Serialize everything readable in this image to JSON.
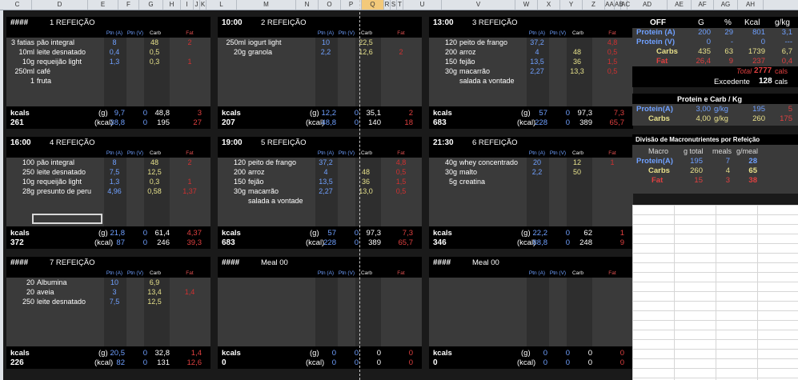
{
  "columns": [
    "C",
    "D",
    "E",
    "F",
    "G",
    "H",
    "I",
    "J",
    "K",
    "L",
    "M",
    "N",
    "O",
    "P",
    "Q",
    "R",
    "S",
    "T",
    "U",
    "V",
    "W",
    "X",
    "Y",
    "Z",
    "AA",
    "AB",
    "AC",
    "AD",
    "AE",
    "AF",
    "AG",
    "AH"
  ],
  "selected_column": "Q",
  "sub_headers": {
    "ptn_a": "Ptn (A)",
    "ptn_v": "Ptn (V)",
    "carb": "Carb",
    "fat": "Fat"
  },
  "labels": {
    "kcals": "kcals",
    "g": "(g)",
    "kcal": "(kcal)"
  },
  "meals": [
    {
      "time": "####",
      "title": "1 REFEIÇÃO",
      "items": [
        {
          "qty": "3 fatias",
          "food": "pão integral",
          "pa": "8",
          "carb": "48",
          "fat": "2"
        },
        {
          "qty": "10ml",
          "food": "leite desnatado",
          "pa": "0,4",
          "carb": "0,5",
          "fat": ""
        },
        {
          "qty": "10g",
          "food": "requeijão light",
          "pa": "1,3",
          "carb": "0,3",
          "fat": "1"
        },
        {
          "qty": "250ml",
          "food": "café",
          "pa": "",
          "carb": "",
          "fat": ""
        },
        {
          "qty": "1",
          "food": "fruta",
          "pa": "",
          "carb": "",
          "fat": ""
        }
      ],
      "kcals": "261",
      "g": {
        "pa": "9,7",
        "pv": "0",
        "carb": "48,8",
        "fat": "3"
      },
      "kcal": {
        "pa": "38,8",
        "pv": "0",
        "carb": "195",
        "fat": "27"
      }
    },
    {
      "time": "10:00",
      "title": "2 REFEIÇÃO",
      "items": [
        {
          "qty": "250ml",
          "food": "iogurt light",
          "pa": "10",
          "carb": "22,5",
          "fat": ""
        },
        {
          "qty": "20g",
          "food": "granola",
          "pa": "2,2",
          "carb": "12,6",
          "fat": "2"
        }
      ],
      "kcals": "207",
      "g": {
        "pa": "12,2",
        "pv": "0",
        "carb": "35,1",
        "fat": "2"
      },
      "kcal": {
        "pa": "48,8",
        "pv": "0",
        "carb": "140",
        "fat": "18"
      }
    },
    {
      "time": "13:00",
      "title": "3 REFEIÇÃO",
      "items": [
        {
          "qty": "120",
          "food": "peito de frango",
          "pa": "37,2",
          "carb": "",
          "fat": "4,8"
        },
        {
          "qty": "200",
          "food": "arroz",
          "pa": "4",
          "carb": "48",
          "fat": "0,5"
        },
        {
          "qty": "150",
          "food": "fejão",
          "pa": "13,5",
          "carb": "36",
          "fat": "1,5"
        },
        {
          "qty": "30g",
          "food": "macarrão",
          "pa": "2,27",
          "carb": "13,3",
          "fat": "0,5"
        },
        {
          "qty": "",
          "food": "salada a vontade",
          "pa": "",
          "carb": "",
          "fat": ""
        }
      ],
      "kcals": "683",
      "g": {
        "pa": "57",
        "pv": "0",
        "carb": "97,3",
        "fat": "7,3"
      },
      "kcal": {
        "pa": "228",
        "pv": "0",
        "carb": "389",
        "fat": "65,7"
      }
    },
    {
      "time": "16:00",
      "title": "4 REFEIÇÃO",
      "items": [
        {
          "qty": "100",
          "food": "pão integral",
          "pa": "8",
          "carb": "48",
          "fat": "2"
        },
        {
          "qty": "250",
          "food": "leite desnatado",
          "pa": "7,5",
          "carb": "12,5",
          "fat": ""
        },
        {
          "qty": "10g",
          "food": "requeijão light",
          "pa": "1,3",
          "carb": "0,3",
          "fat": "1"
        },
        {
          "qty": "28g",
          "food": "presunto de peru",
          "pa": "4,96",
          "carb": "0,58",
          "fat": "1,37"
        }
      ],
      "kcals": "372",
      "g": {
        "pa": "21,8",
        "pv": "0",
        "carb": "61,4",
        "fat": "4,37"
      },
      "kcal": {
        "pa": "87",
        "pv": "0",
        "carb": "246",
        "fat": "39,3"
      }
    },
    {
      "time": "19:00",
      "title": "5 REFEIÇÃO",
      "items": [
        {
          "qty": "120",
          "food": "peito de frango",
          "pa": "37,2",
          "carb": "",
          "fat": "4,8"
        },
        {
          "qty": "200",
          "food": "arroz",
          "pa": "4",
          "carb": "48",
          "fat": "0,5"
        },
        {
          "qty": "150",
          "food": "fejão",
          "pa": "13,5",
          "carb": "36",
          "fat": "1,5"
        },
        {
          "qty": "30g",
          "food": "macarrão",
          "pa": "2,27",
          "carb": "13,0",
          "fat": "0,5"
        },
        {
          "qty": "",
          "food": "salada a vontade",
          "pa": "",
          "carb": "",
          "fat": ""
        }
      ],
      "kcals": "683",
      "g": {
        "pa": "57",
        "pv": "0",
        "carb": "97,3",
        "fat": "7,3"
      },
      "kcal": {
        "pa": "228",
        "pv": "0",
        "carb": "389",
        "fat": "65,7"
      }
    },
    {
      "time": "21:30",
      "title": "6 REFEIÇÃO",
      "items": [
        {
          "qty": "40g",
          "food": "whey concentrado",
          "pa": "20",
          "carb": "12",
          "fat": "1"
        },
        {
          "qty": "30g",
          "food": "malto",
          "pa": "2,2",
          "carb": "50",
          "fat": ""
        },
        {
          "qty": "5g",
          "food": "creatina",
          "pa": "",
          "carb": "",
          "fat": ""
        }
      ],
      "kcals": "346",
      "g": {
        "pa": "22,2",
        "pv": "0",
        "carb": "62",
        "fat": "1"
      },
      "kcal": {
        "pa": "88,8",
        "pv": "0",
        "carb": "248",
        "fat": "9"
      }
    },
    {
      "time": "####",
      "title": "7 REFEIÇÃO",
      "items": [
        {
          "qty": "20",
          "food": "Albumina",
          "pa": "10",
          "carb": "6,9",
          "fat": ""
        },
        {
          "qty": "20",
          "food": "aveia",
          "pa": "3",
          "carb": "13,4",
          "fat": "1,4"
        },
        {
          "qty": "250",
          "food": "leite desnatado",
          "pa": "7,5",
          "carb": "12,5",
          "fat": ""
        }
      ],
      "kcals": "226",
      "g": {
        "pa": "20,5",
        "pv": "0",
        "carb": "32,8",
        "fat": "1,4"
      },
      "kcal": {
        "pa": "82",
        "pv": "0",
        "carb": "131",
        "fat": "12,6"
      }
    },
    {
      "time": "####",
      "title": "Meal 00",
      "items": [],
      "kcals": "0",
      "g": {
        "pa": "0",
        "pv": "0",
        "carb": "0",
        "fat": "0"
      },
      "kcal": {
        "pa": "0",
        "pv": "0",
        "carb": "0",
        "fat": "0"
      }
    },
    {
      "time": "####",
      "title": "Meal 00",
      "items": [],
      "kcals": "0",
      "g": {
        "pa": "0",
        "pv": "0",
        "carb": "0",
        "fat": "0"
      },
      "kcal": {
        "pa": "0",
        "pv": "0",
        "carb": "0",
        "fat": "0"
      }
    }
  ],
  "summary": {
    "headers": {
      "mode": "OFF",
      "g": "G",
      "pct": "%",
      "kcal": "Kcal",
      "gkg": "g/kg"
    },
    "rows": [
      {
        "label": "Protein (A)",
        "g": "200",
        "pct": "29",
        "kcal": "801",
        "gkg": "3,1"
      },
      {
        "label": "Protein (V)",
        "g": "0",
        "pct": "-",
        "kcal": "0",
        "gkg": "---"
      },
      {
        "label": "Carbs",
        "g": "435",
        "pct": "63",
        "kcal": "1739",
        "gkg": "6,7"
      },
      {
        "label": "Fat",
        "g": "26,4",
        "pct": "9",
        "kcal": "237",
        "gkg": "0,4"
      }
    ],
    "total_label": "Total",
    "total_value": "2777",
    "total_unit": "cals",
    "exc_label": "Excedente",
    "exc_value": "128",
    "exc_unit": "cals"
  },
  "pc": {
    "title": "Protein e Carb / Kg",
    "rows": [
      {
        "label": "Protein(A)",
        "v": "3,00",
        "unit": "g/kg",
        "g": "195",
        "diff": "5"
      },
      {
        "label": "Carbs",
        "v": "4,00",
        "unit": "g/kg",
        "g": "260",
        "diff": "175"
      }
    ]
  },
  "div": {
    "title": "Divisão de Macronutrientes por Refeição",
    "headers": {
      "macro": "Macro",
      "total": "g total",
      "meals": "meals",
      "gmeal": "g/meal"
    },
    "rows": [
      {
        "label": "Protein(A)",
        "total": "195",
        "meals": "7",
        "gmeal": "28"
      },
      {
        "label": "Carbs",
        "total": "260",
        "meals": "4",
        "gmeal": "65"
      },
      {
        "label": "Fat",
        "total": "15",
        "meals": "3",
        "gmeal": "38"
      }
    ]
  }
}
